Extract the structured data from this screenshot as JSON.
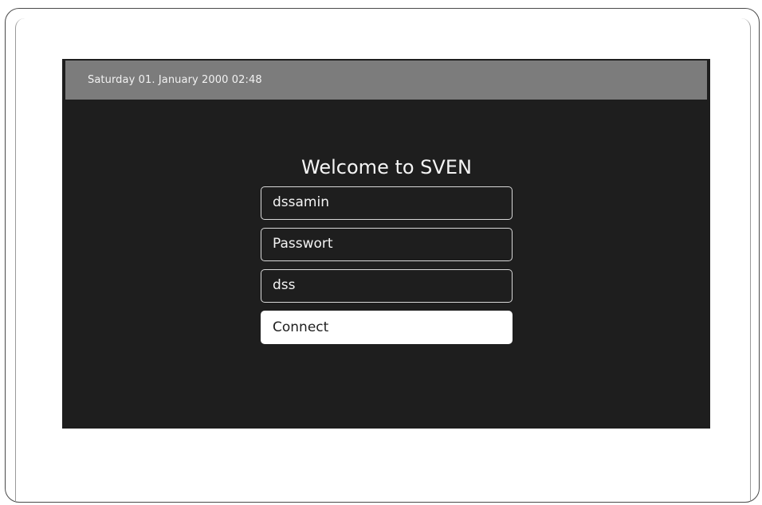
{
  "status_bar": {
    "datetime": "Saturday 01. January 2000 02:48"
  },
  "login": {
    "title": "Welcome to SVEN",
    "username_value": "dssamin",
    "password_placeholder": "Passwort",
    "third_field_value": "dss",
    "connect_label": "Connect"
  },
  "colors": {
    "screen_background": "#1e1e1e",
    "status_bar_background": "#7c7c7c",
    "field_border": "#d8d8d8",
    "button_background": "#ffffff"
  }
}
